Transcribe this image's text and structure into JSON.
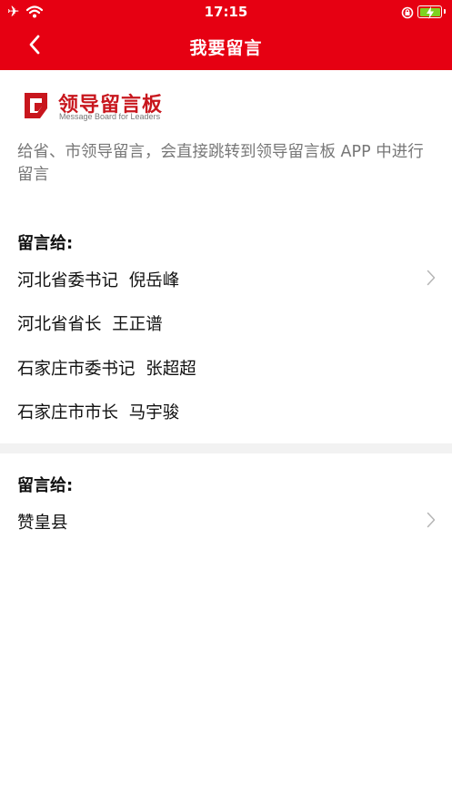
{
  "status_bar": {
    "time": "17:15",
    "plane_icon": "✈",
    "battery_color": "#7ed321"
  },
  "nav": {
    "title": "我要留言",
    "background": "#e60012"
  },
  "logo": {
    "name": "领导留言板",
    "subtitle": "Message Board for Leaders",
    "color": "#c8161d"
  },
  "description": "给省、市领导留言，会直接跳转到领导留言板 APP 中进行留言",
  "sections": [
    {
      "label": "留言给:",
      "items": [
        "河北省委书记  倪岳峰",
        "河北省省长  王正谱",
        "石家庄市委书记  张超超",
        "石家庄市市长  马宇骏"
      ]
    },
    {
      "label": "留言给:",
      "items": [
        "赞皇县"
      ]
    }
  ]
}
